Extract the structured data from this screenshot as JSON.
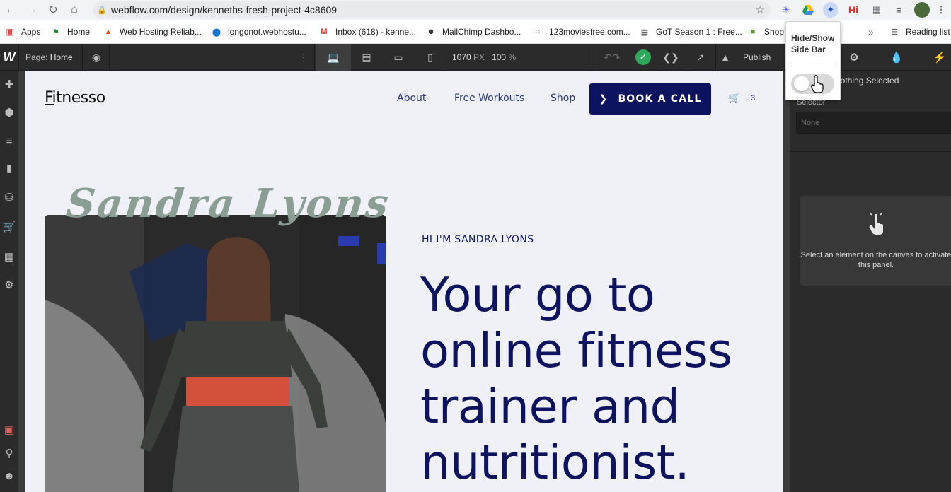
{
  "browser": {
    "url": "webflow.com/design/kenneths-fresh-project-4c8609",
    "bookmarks": [
      "Apps",
      "Home",
      "Web Hosting Reliab...",
      "longonot.webhostu...",
      "Inbox (618) - kenne...",
      "MailChimp Dashbo...",
      "123moviesfree.com...",
      "GoT Season 1 : Free...",
      "Shop"
    ],
    "reading_list": "Reading list",
    "more_bookmarks": "»"
  },
  "extension_popup": {
    "title": "Hide/Show Side Bar"
  },
  "designer": {
    "page_label": "Page:",
    "page_name": "Home",
    "canvas_width": "1070",
    "canvas_width_unit": "PX",
    "zoom": "100",
    "zoom_unit": "%",
    "publish_label": "Publish",
    "right_panel": {
      "header": "Nothing Selected",
      "selector_label": "Selector",
      "selector_value": "None",
      "empty_message": "Select an element on the canvas to activate this panel."
    }
  },
  "site": {
    "logo": "Fitnesso",
    "nav": [
      "About",
      "Free Workouts",
      "Shop"
    ],
    "cta": "BOOK A CALL",
    "cart_count": "3",
    "hero_name": "Sandra Lyons",
    "hero_intro": "HI I'M SANDRA LYONS",
    "hero_title": "Your go to online fitness trainer and nutritionist."
  },
  "colors": {
    "brand_navy": "#0e1360",
    "name_sage": "#8a9e94",
    "canvas_bg": "#f0f1f6",
    "designer_dark": "#2b2b2b"
  }
}
